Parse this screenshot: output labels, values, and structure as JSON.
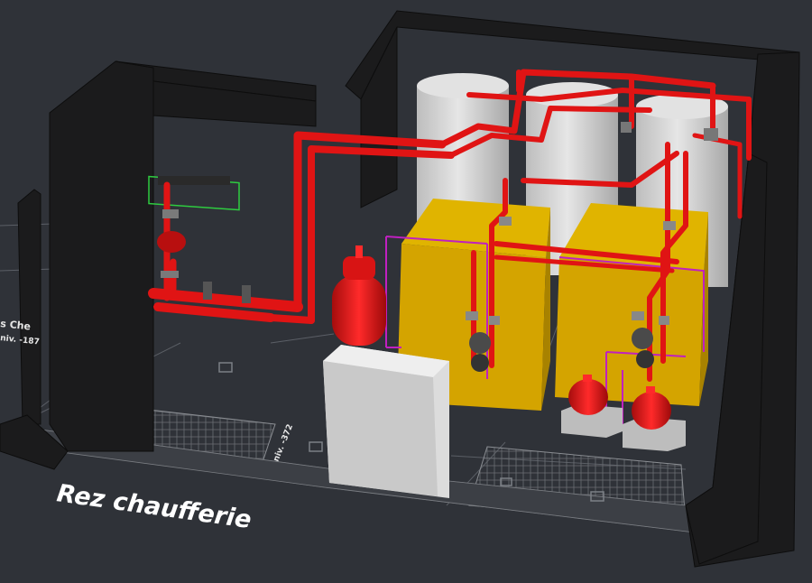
{
  "labels": {
    "room": "Rez chaufferie",
    "level_a": "niv. -372",
    "level_b": "niv. -187",
    "room_fragment": "s Che"
  },
  "colors": {
    "background": "#2f3238",
    "walls": "#1b1b1c",
    "piping": "#e01414",
    "boiler": "#d4a400",
    "tank": "#cfcfcf",
    "cabinet": "#cccccc",
    "electrical": "#c020c0",
    "selection": "#2ecc40"
  }
}
